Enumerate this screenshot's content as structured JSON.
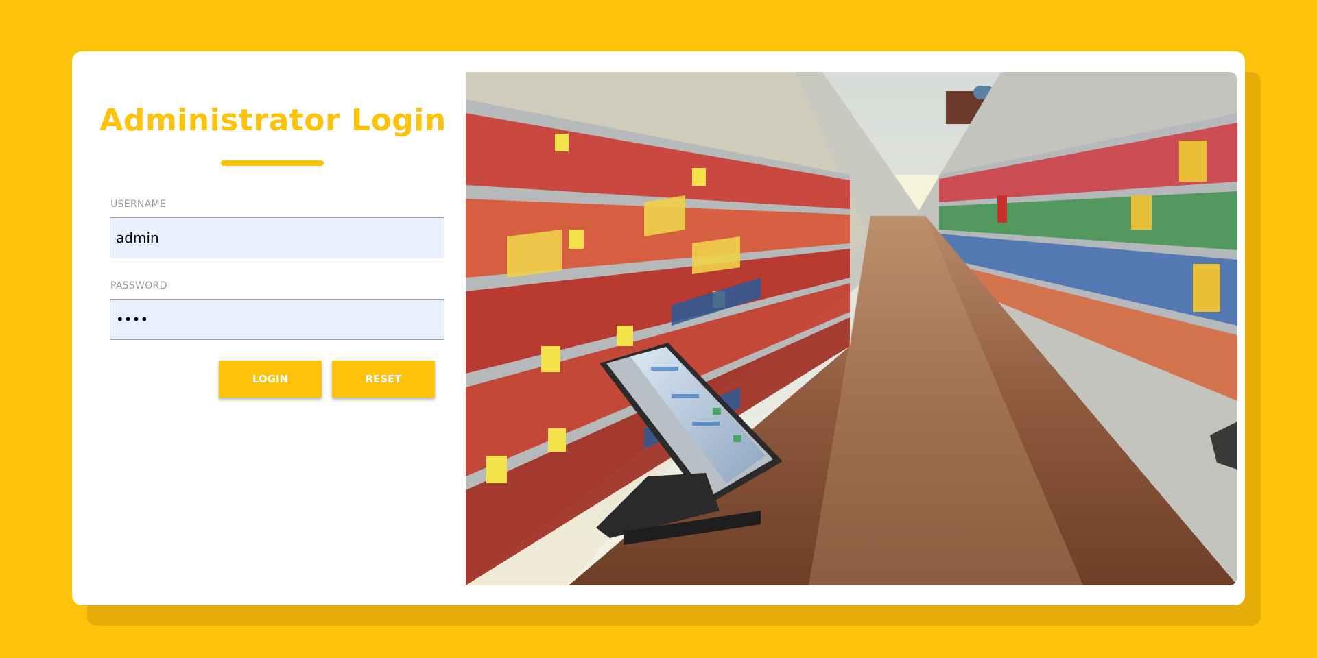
{
  "login": {
    "title": "Administrator Login",
    "username_label": "USERNAME",
    "username_value": "admin",
    "password_label": "PASSWORD",
    "password_value": "1234",
    "login_label": "LOGIN",
    "reset_label": "RESET"
  },
  "colors": {
    "accent": "#FDC20A",
    "input_background": "#E8F0FE"
  },
  "hero": {
    "image_subject": "supermarket-aisle-with-pos-terminal"
  }
}
